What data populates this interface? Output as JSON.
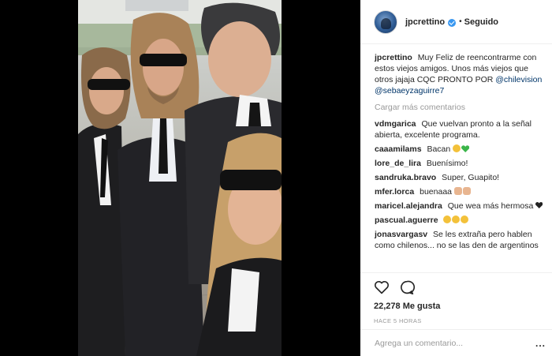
{
  "post": {
    "username": "jpcrettino",
    "follow_status": "Seguido",
    "separator": "•",
    "caption": {
      "username": "jpcrettino",
      "text": "Muy Feliz de reencontrarme con estos viejos amigos. Unos más viejos que otros jajaja CQC PRONTO POR",
      "mention1": "@chilevision",
      "mention2": "@sebaeyzaguirre7"
    },
    "load_more": "Cargar más comentarios",
    "comments": [
      {
        "user": "vdmgarica",
        "text": "Que vuelvan pronto a la señal abierta, excelente programa."
      },
      {
        "user": "caaamilams",
        "text": "Bacan"
      },
      {
        "user": "lore_de_lira",
        "text": "Buenísimo!"
      },
      {
        "user": "sandruka.bravo",
        "text": "Super, Guapito!"
      },
      {
        "user": "mfer.lorca",
        "text": "buenaaa"
      },
      {
        "user": "maricel.alejandra",
        "text": "Que wea más hermosa"
      },
      {
        "user": "pascual.aguerre",
        "text": ""
      },
      {
        "user": "jonasvargasv",
        "text": "Se les extraña pero hablen como chilenos... no se las den de argentinos"
      }
    ],
    "likes": "22,278 Me gusta",
    "time": "HACE 5 HORAS",
    "add_comment_placeholder": "Agrega un comentario...",
    "more_options": "...",
    "colors": {
      "verified": "#3897f0",
      "link": "#003569",
      "muted": "#999999"
    },
    "icons": [
      "heart-icon",
      "comment-icon",
      "verified-icon",
      "more-options-icon"
    ]
  }
}
